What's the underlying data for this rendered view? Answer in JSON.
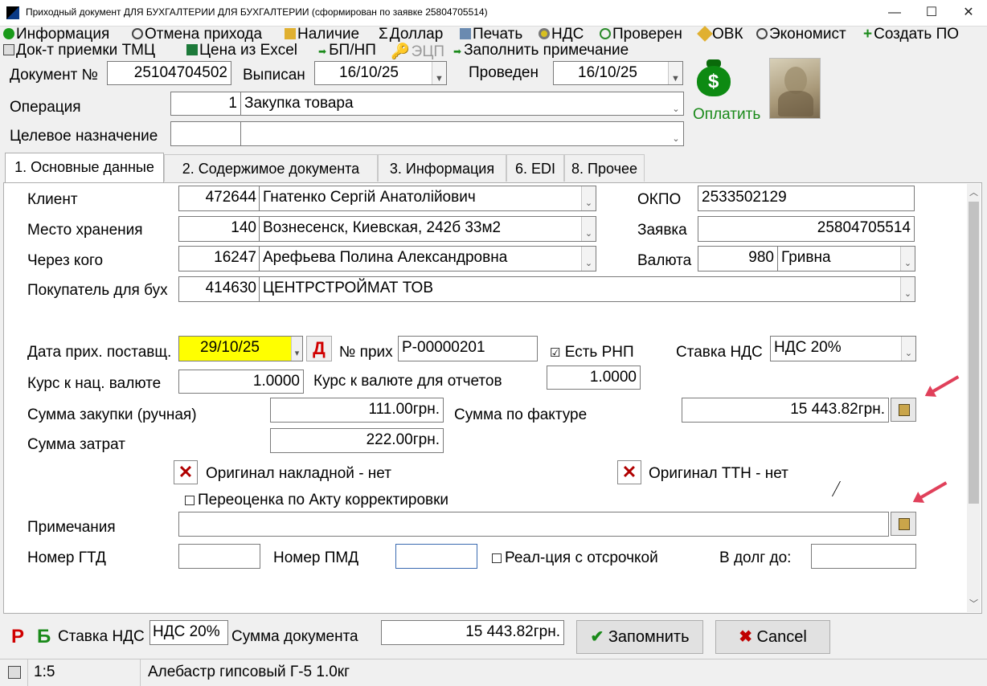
{
  "window": {
    "title": "Приходный документ  ДЛЯ БУХГАЛТЕРИИ  ДЛЯ БУХГАЛТЕРИИ (сформирован по заявке 25804705514)",
    "minimize": "—",
    "maximize": "☐",
    "close": "✕"
  },
  "toolbar": {
    "row1": [
      "Информация",
      "Отмена прихода",
      "Наличие",
      "Доллар",
      "Печать",
      "НДС",
      "Проверен",
      "ОВК",
      "Экономист",
      "Создать ПО"
    ],
    "row2": [
      "Док-т приемки ТМЦ",
      "Цена из Excel",
      "БП/НП",
      "ЭЦП",
      "Заполнить примечание"
    ]
  },
  "header": {
    "doc_label": "Документ №",
    "doc_number": "25104704502",
    "issued_label": "Выписан",
    "issued_date": "16/10/25",
    "posted_label": "Проведен",
    "posted_date": "16/10/25",
    "operation_label": "Операция",
    "operation_code": "1",
    "operation_name": "Закупка товара",
    "purpose_label": "Целевое назначение",
    "purpose_code": "",
    "purpose_name": "",
    "pay_label": "Оплатить"
  },
  "tabs": [
    "1. Основные данные",
    "2. Содержимое документа",
    "3. Информация",
    "6. EDI",
    "8. Прочее"
  ],
  "main": {
    "client_label": "Клиент",
    "client_code": "472644",
    "client_name": "Гнатенко Сергій Анатолійович",
    "okpo_label": "ОКПО",
    "okpo_value": "2533502129",
    "storage_label": "Место хранения",
    "storage_code": "140",
    "storage_name": "Вознесенск, Киевская, 242б 33м2",
    "request_label": "Заявка",
    "request_value": "25804705514",
    "via_label": "Через кого",
    "via_code": "16247",
    "via_name": "Арефьева Полина Александровна",
    "currency_label": "Валюта",
    "currency_code": "980",
    "currency_name": "Гривна",
    "buyer_label": "Покупатель для бух",
    "buyer_code": "414630",
    "buyer_name": "ЦЕНТРСТРОЙМАТ ТОВ",
    "supplier_date_label": "Дата прих. поставщ.",
    "supplier_date": "29/10/25",
    "d_button": "Д",
    "receipt_no_label": "№ прих",
    "receipt_no": "Р-00000201",
    "rnp_label": "Есть РНП",
    "vat_rate_label": "Ставка НДС",
    "vat_rate": "НДС 20%",
    "rate_nat_label": "Курс к нац. валюте",
    "rate_nat": "1.0000",
    "rate_report_label": "Курс к валюте для отчетов",
    "rate_report": "1.0000",
    "purchase_sum_label": "Сумма закупки (ручная)",
    "purchase_sum": "111.00грн.",
    "invoice_sum_label": "Сумма по фактуре",
    "invoice_sum": "15 443.82грн.",
    "costs_label": "Сумма затрат",
    "costs_sum": "222.00грн.",
    "orig_invoice_label": "Оригинал накладной - нет",
    "orig_ttn_label": "Оригинал ТТН - нет",
    "revaluation_label": "Переоценка по Акту корректировки",
    "notes_label": "Примечания",
    "notes_value": "",
    "gtd_label": "Номер ГТД",
    "gtd_value": "",
    "pmd_label": "Номер ПМД",
    "pmd_value": "",
    "deferred_label": "Реал-ция с отсрочкой",
    "debt_label": "В долг до:",
    "debt_value": ""
  },
  "footer": {
    "r_mark": "Р",
    "b_mark": "Б",
    "vat_label": "Ставка НДС",
    "vat_value": "НДС 20%",
    "doc_sum_label": "Сумма документа",
    "doc_sum": "15 443.82грн.",
    "save_label": "Запомнить",
    "cancel_label": "Cancel"
  },
  "status": {
    "position": "1:5",
    "item": "Алебастр гипсовый Г-5  1.0кг"
  },
  "colors": {
    "highlight_yellow": "#ffff00",
    "pay_green": "#1a8a1a",
    "danger_red": "#c00000",
    "arrow_pink": "#e0405a"
  }
}
